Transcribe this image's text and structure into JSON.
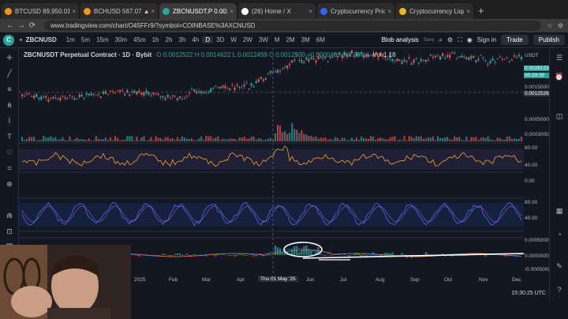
{
  "browser": {
    "tabs": [
      {
        "title": "BTCUSD 89,950.01 ▲ +2.39%",
        "color": "#f7931a",
        "active": false
      },
      {
        "title": "BCHUSD 567.07 ▲ +3.84%",
        "color": "#f7931a",
        "active": false
      },
      {
        "title": "ZBCNUSDT.P 0.0026123 ▲",
        "color": "#26a69a",
        "active": true
      },
      {
        "title": "(26) Home / X",
        "color": "#ffffff",
        "active": false
      },
      {
        "title": "Cryptocurrency Prices, Chart",
        "color": "#3861fb",
        "active": false
      },
      {
        "title": "Cryptocurrency Liquidation",
        "color": "#f0b90b",
        "active": false
      }
    ],
    "url": "www.tradingview.com/chart/O45FFr9/?symbol=COINBASE%3AXCNUSD"
  },
  "toolbar": {
    "symbol": "ZBCNUSD",
    "timeframes": [
      "1m",
      "5m",
      "15m",
      "30m",
      "45m",
      "1h",
      "2h",
      "3h",
      "4h",
      "D",
      "3D",
      "W",
      "2W",
      "3W",
      "M",
      "2M",
      "3M",
      "6M"
    ],
    "selected_timeframe": "D",
    "layout_name": "Blob analysis",
    "layout_status": "Save",
    "signin_label": "Sign in",
    "trade_label": "Trade",
    "publish_label": "Publish"
  },
  "legend": {
    "pair": "ZBCNUSDT Perpetual Contract · 1D · Bybit",
    "ohlc": "O 0.0012522 H 0.0014622 L 0.0012499 C 0.0012930 +0.0000408 (+3.28%)",
    "vol": "Vol 1.18"
  },
  "price_axis": {
    "currency": "USDT",
    "labels": [
      "0.0026123",
      "00:29:35",
      "0.0015000",
      "0.0012526",
      "0.0005000",
      "0.0003000",
      "80.00",
      "40.00",
      "0.00",
      "80.00",
      "40.00",
      "0.0005000",
      "0.0000000",
      "-0.0005000"
    ],
    "current_price": "0.0026123",
    "countdown": "00:29:35",
    "crosshair_price": "0.0012526"
  },
  "time_axis": {
    "labels": [
      "2025",
      "Feb",
      "Mar",
      "Apr",
      "Thu 01 May '25",
      "Jun",
      "Jul",
      "Aug",
      "Sep",
      "Oct",
      "Nov",
      "Dec"
    ],
    "crosshair_label": "Thu 01 May '25"
  },
  "status": {
    "clock": "15:30:25 UTC"
  },
  "colors": {
    "up": "#26a69a",
    "down": "#ef5350",
    "rsi": "#f5a623",
    "stoch_k": "#4f6bed",
    "stoch_d": "#b06cf0",
    "background": "#131722"
  }
}
